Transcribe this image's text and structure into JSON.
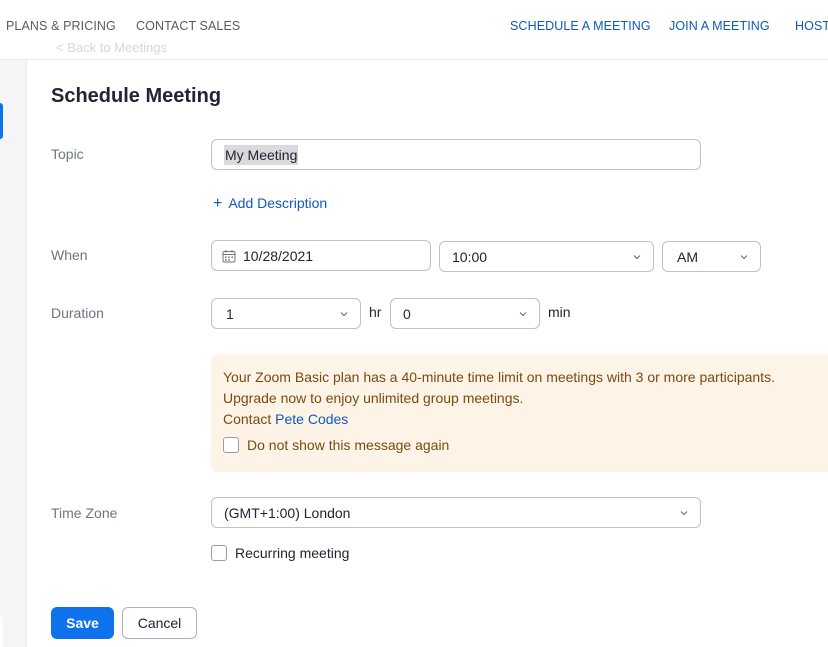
{
  "top_nav": {
    "left": [
      "PLANS & PRICING",
      "CONTACT SALES"
    ],
    "right": [
      "SCHEDULE A MEETING",
      "JOIN A MEETING",
      "HOST"
    ]
  },
  "ghost_breadcrumb": "< Back to Meetings",
  "page": {
    "title": "Schedule Meeting"
  },
  "form": {
    "topic": {
      "label": "Topic",
      "value": "My Meeting"
    },
    "add_description": {
      "icon": "plus-icon",
      "label": "Add Description"
    },
    "when": {
      "label": "When",
      "date": "10/28/2021",
      "time": "10:00",
      "ampm": "AM"
    },
    "duration": {
      "label": "Duration",
      "hours": "1",
      "hours_unit": "hr",
      "minutes": "0",
      "minutes_unit": "min"
    },
    "notice": {
      "line1": "Your Zoom Basic plan has a 40-minute time limit on meetings with 3 or more participants.",
      "line2": "Upgrade now to enjoy unlimited group meetings.",
      "contact_prefix": "Contact ",
      "contact_link": "Pete Codes",
      "dont_show": "Do not show this message again"
    },
    "timezone": {
      "label": "Time Zone",
      "value": "(GMT+1:00) London"
    },
    "recurring": {
      "label": "Recurring meeting",
      "checked": false
    }
  },
  "actions": {
    "save": "Save",
    "cancel": "Cancel"
  },
  "colors": {
    "primary": "#0e72ed",
    "link": "#0e5ab9",
    "notice_bg": "#fdf3e7",
    "notice_text": "#7a4a10"
  }
}
